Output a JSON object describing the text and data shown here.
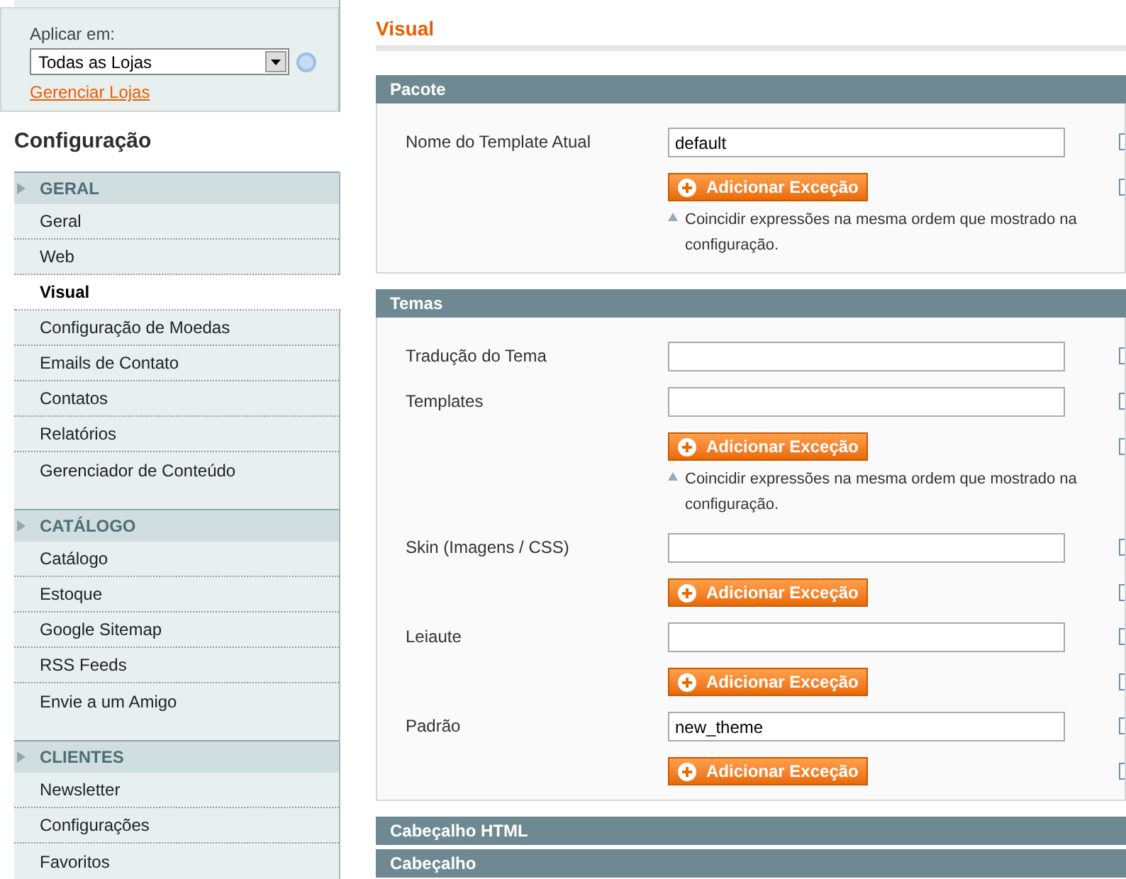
{
  "scope": {
    "label": "Aplicar em:",
    "value": "Todas as Lojas",
    "link": "Gerenciar Lojas"
  },
  "sidebar": {
    "title": "Configuração",
    "groups": [
      {
        "title": "GERAL",
        "items": [
          {
            "label": "Geral",
            "selected": false
          },
          {
            "label": "Web",
            "selected": false
          },
          {
            "label": "Visual",
            "selected": true
          },
          {
            "label": "Configuração de Moedas",
            "selected": false
          },
          {
            "label": "Emails de Contato",
            "selected": false
          },
          {
            "label": "Contatos",
            "selected": false
          },
          {
            "label": "Relatórios",
            "selected": false
          },
          {
            "label": "Gerenciador de Conteúdo",
            "selected": false
          }
        ]
      },
      {
        "title": "CATÁLOGO",
        "items": [
          {
            "label": "Catálogo",
            "selected": false
          },
          {
            "label": "Estoque",
            "selected": false
          },
          {
            "label": "Google Sitemap",
            "selected": false
          },
          {
            "label": "RSS Feeds",
            "selected": false
          },
          {
            "label": "Envie a um Amigo",
            "selected": false
          }
        ]
      },
      {
        "title": "CLIENTES",
        "items": [
          {
            "label": "Newsletter",
            "selected": false
          },
          {
            "label": "Configurações",
            "selected": false
          },
          {
            "label": "Favoritos",
            "selected": false
          }
        ]
      }
    ]
  },
  "page_title": "Visual",
  "sections": [
    {
      "title": "Pacote",
      "expanded": true,
      "rows": [
        {
          "kind": "field",
          "label": "Nome do Template Atual",
          "value": "default",
          "use_default": false
        },
        {
          "kind": "button",
          "label": "Adicionar Exceção",
          "note": "Coincidir expressões na mesma ordem que mostrado na configuração.",
          "use_default": false
        }
      ]
    },
    {
      "title": "Temas",
      "expanded": true,
      "rows": [
        {
          "kind": "field",
          "label": "Tradução do Tema",
          "use_default": false
        },
        {
          "kind": "field",
          "label": "Templates",
          "use_default": false
        },
        {
          "kind": "button",
          "label": "Adicionar Exceção",
          "note": "Coincidir expressões na mesma ordem que mostrado na configuração.",
          "use_default": false
        },
        {
          "kind": "field",
          "label": "Skin (Imagens / CSS)",
          "use_default": false
        },
        {
          "kind": "button",
          "label": "Adicionar Exceção",
          "use_default": false
        },
        {
          "kind": "field",
          "label": "Leiaute",
          "use_default": false
        },
        {
          "kind": "button",
          "label": "Adicionar Exceção",
          "use_default": false
        },
        {
          "kind": "field",
          "label": "Padrão",
          "value": "new_theme",
          "use_default": false
        },
        {
          "kind": "button",
          "label": "Adicionar Exceção",
          "use_default": false
        }
      ]
    },
    {
      "title": "Cabeçalho HTML",
      "expanded": false
    },
    {
      "title": "Cabeçalho",
      "expanded": false
    }
  ]
}
